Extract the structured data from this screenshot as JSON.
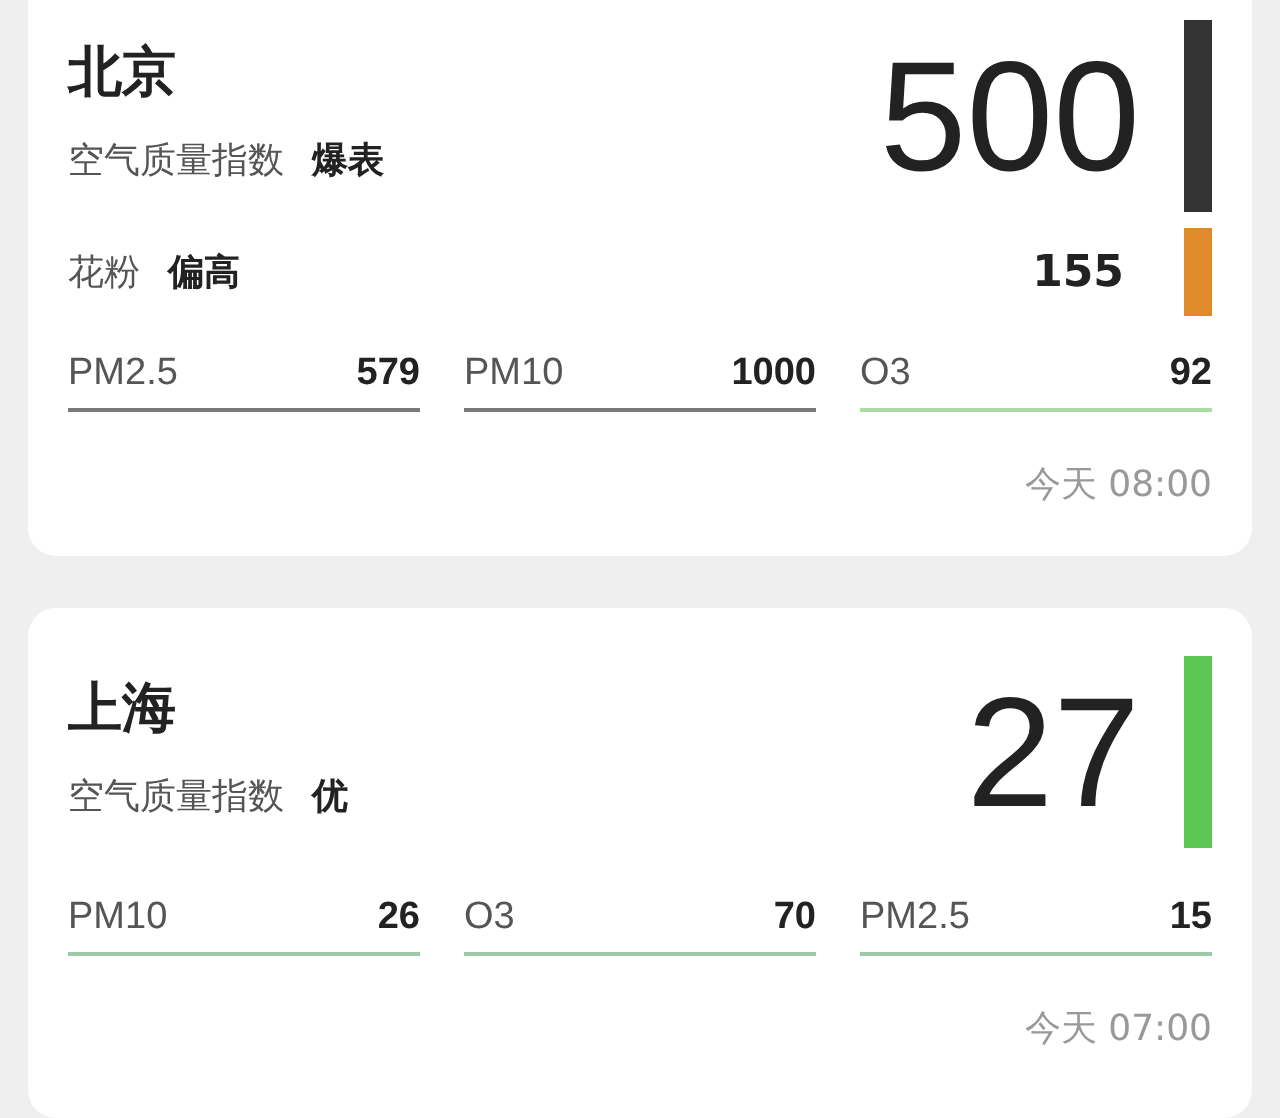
{
  "cards": [
    {
      "city": "北京",
      "index_label": "空气质量指数",
      "index_level": "爆表",
      "aqi": "500",
      "color": "#333333",
      "pollen": {
        "label": "花粉",
        "level": "偏高",
        "value": "155",
        "color": "#e08a2c"
      },
      "pollutants": [
        {
          "name": "PM2.5",
          "value": "579",
          "color": "#7a7a7a"
        },
        {
          "name": "PM10",
          "value": "1000",
          "color": "#7a7a7a"
        },
        {
          "name": "O3",
          "value": "92",
          "color": "#a8dca0"
        }
      ],
      "time": "今天 08:00"
    },
    {
      "city": "上海",
      "index_label": "空气质量指数",
      "index_level": "优",
      "aqi": "27",
      "color": "#5cc653",
      "pollutants": [
        {
          "name": "PM10",
          "value": "26",
          "color": "#9cc9a8"
        },
        {
          "name": "O3",
          "value": "70",
          "color": "#9cc9a8"
        },
        {
          "name": "PM2.5",
          "value": "15",
          "color": "#9cc9a8"
        }
      ],
      "time": "今天 07:00"
    }
  ]
}
